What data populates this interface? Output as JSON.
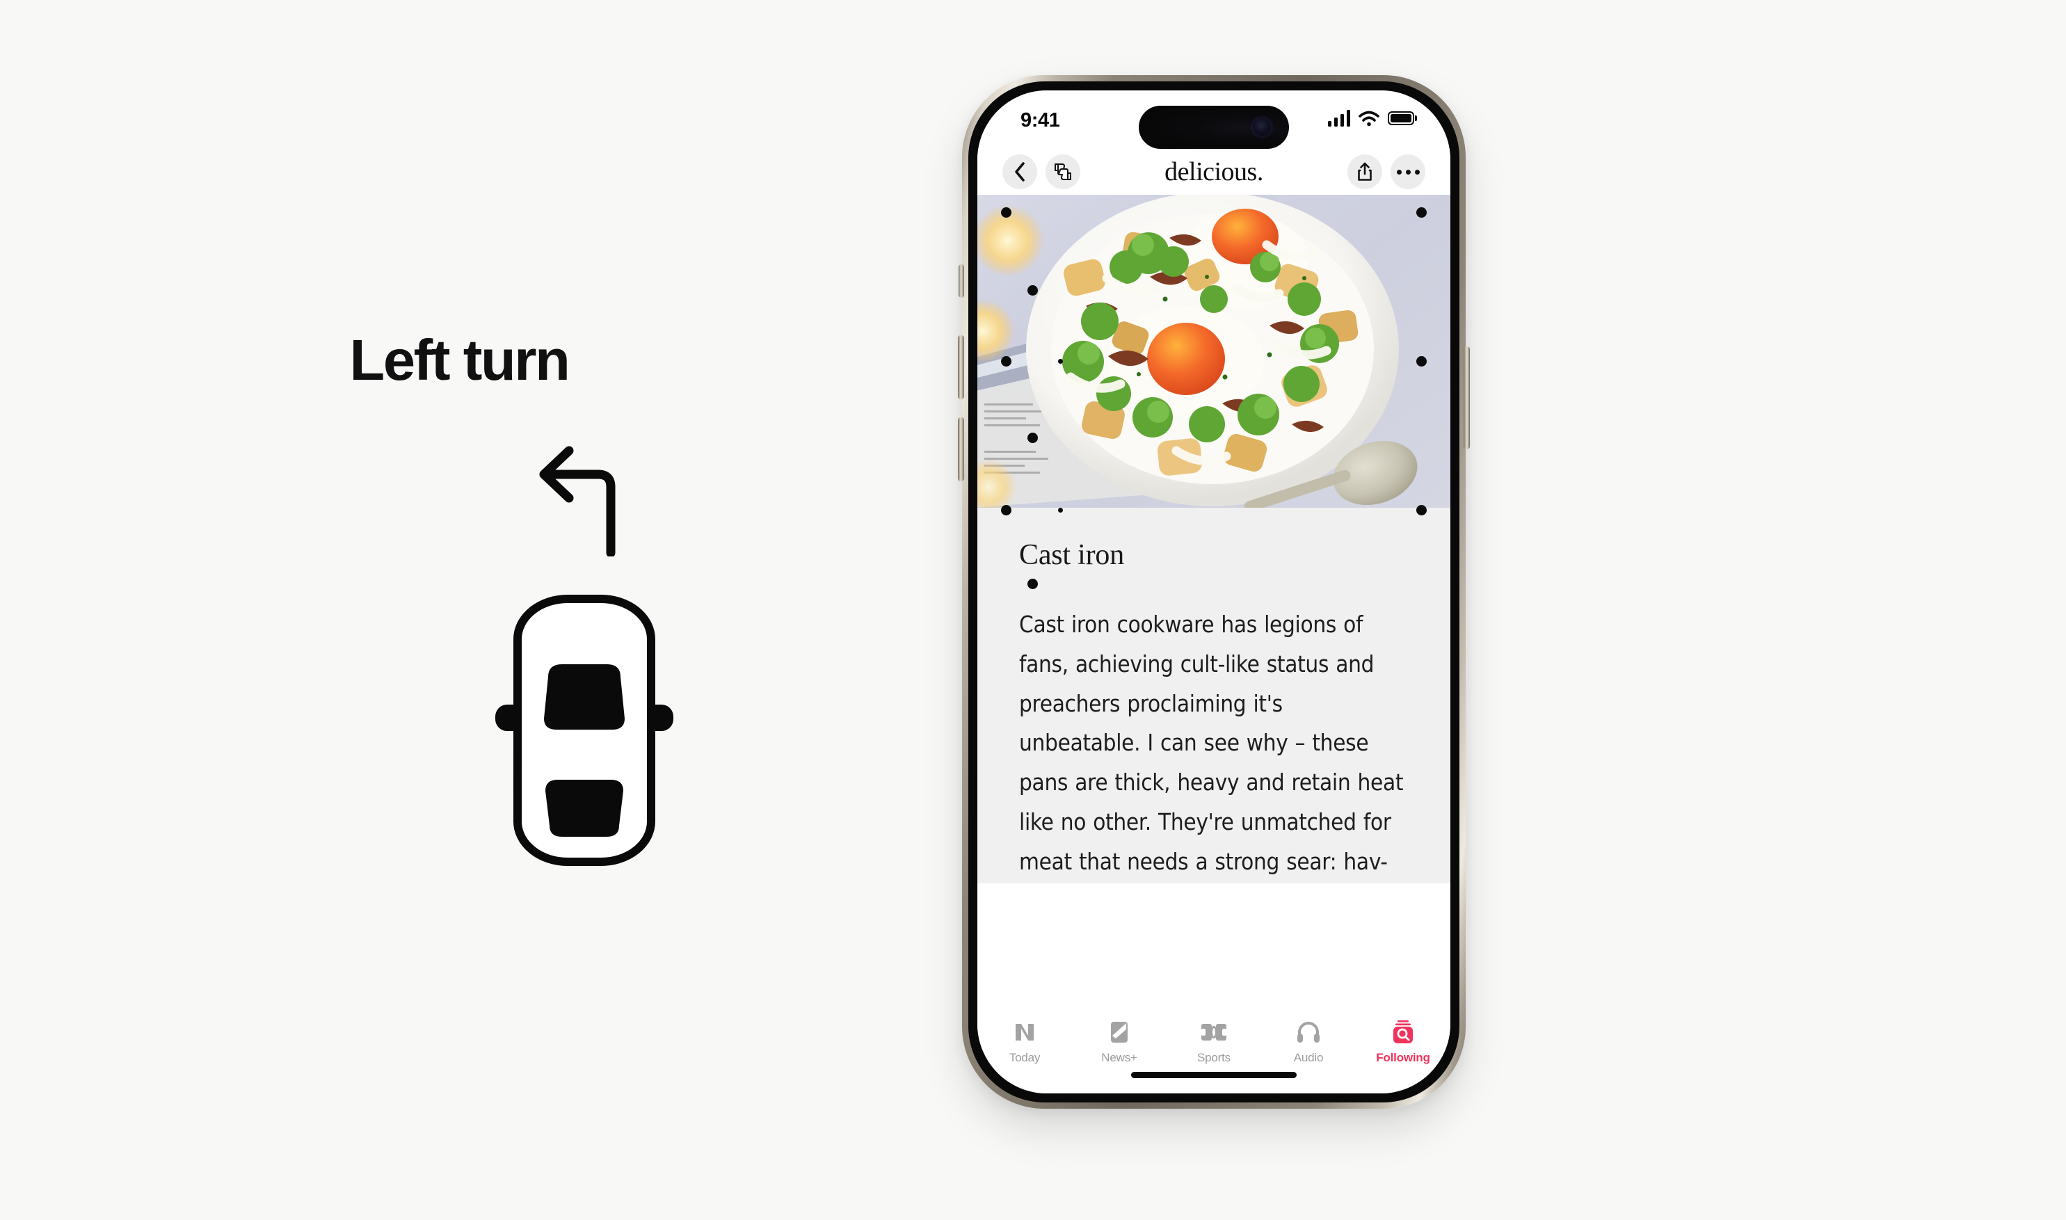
{
  "left_panel": {
    "title": "Left turn",
    "arrow_icon": "left-turn-arrow-icon",
    "vehicle_icon": "car-top-view-icon"
  },
  "phone": {
    "status_bar": {
      "time": "9:41",
      "cellular_icon": "signal-bars-icon",
      "cellular_bars": 4,
      "wifi_icon": "wifi-icon",
      "battery_icon": "battery-full-icon",
      "battery_level": 100
    },
    "nav_bar": {
      "back_icon": "chevron-left-icon",
      "feedback_icon": "thumbs-up-down-icon",
      "title": "delicious.",
      "share_icon": "share-icon",
      "more_icon": "ellipsis-icon"
    },
    "hero": {
      "alt": "Fried eggs with potatoes, kale and bacon on a white oval plate"
    },
    "article": {
      "heading": "Cast iron",
      "body": "Cast iron cookware has legions of fans, achieving cult-like status and preachers proclaiming it's unbeatable. I can see why – these pans are thick, heavy and retain heat like no other. They're unmatched for meat that needs a strong sear: hav-"
    },
    "tab_bar": {
      "active_color": "#f0325c",
      "inactive_color": "#9b9b9b",
      "tabs": [
        {
          "label": "Today",
          "icon": "news-today-icon",
          "active": false
        },
        {
          "label": "News+",
          "icon": "news-plus-icon",
          "active": false
        },
        {
          "label": "Sports",
          "icon": "sports-icon",
          "active": false
        },
        {
          "label": "Audio",
          "icon": "headphones-icon",
          "active": false
        },
        {
          "label": "Following",
          "icon": "search-following-icon",
          "active": true
        }
      ]
    },
    "hardware": {
      "action_button": "action-button",
      "volume_up": "volume-up-button",
      "volume_down": "volume-down-button",
      "power_button": "power-button",
      "home_indicator": "home-indicator"
    }
  },
  "colors": {
    "page_background": "#f8f8f7",
    "article_background": "#f0f0f0",
    "accent": "#f0325c",
    "text": "#1d1d1d"
  }
}
